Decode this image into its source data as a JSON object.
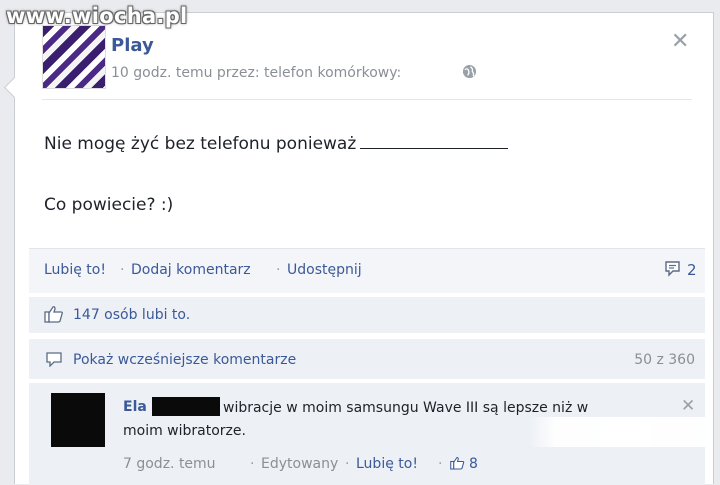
{
  "watermark": "www.wiocha.pl",
  "post": {
    "author": "Play",
    "meta": "10 godz. temu przez: telefon komórkowy:",
    "line1": "Nie mogę żyć bez telefonu ponieważ",
    "line2": "Co powiecie? :)"
  },
  "actions": {
    "like": "Lubię to!",
    "comment": "Dodaj komentarz",
    "share": "Udostępnij",
    "separator": "·",
    "comment_count": "2"
  },
  "likes": {
    "text": "147 osób lubi to."
  },
  "previous_comments": {
    "label": "Pokaż wcześniejsze komentarze",
    "count": "50 z 360"
  },
  "comment": {
    "author": "Ela",
    "text_line1": "wibracje w moim samsungu Wave III są lepsze niż w",
    "text_line2": "moim wibratorze.",
    "time": "7 godz. temu",
    "edited": "Edytowany",
    "like": "Lubię to!",
    "like_count": "8"
  },
  "icons": [
    "close-icon",
    "globe-icon",
    "comment-count-icon",
    "like-thumb-icon",
    "comments-icon"
  ],
  "colors": {
    "link": "#3b5998",
    "meta": "#8a8f96",
    "text": "#1d2129",
    "bar": "#edf0f5"
  }
}
